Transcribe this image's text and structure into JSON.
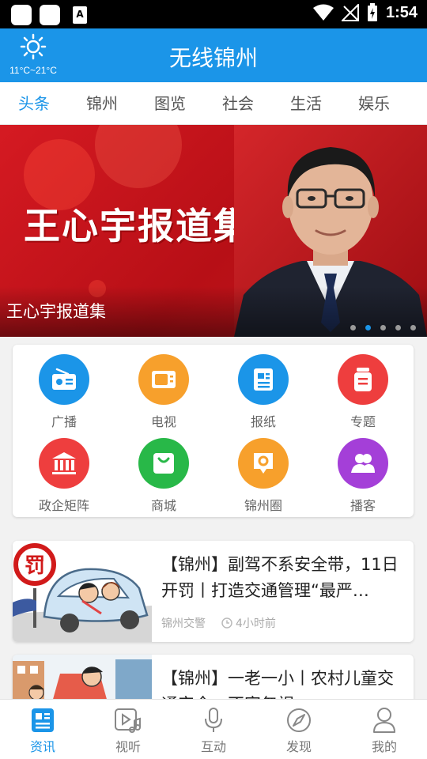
{
  "status_bar": {
    "time": "1:54"
  },
  "header": {
    "title": "无线锦州",
    "weather": {
      "temp": "11°C~21°C",
      "icon": "sun-icon"
    }
  },
  "tabs": [
    {
      "label": "头条",
      "active": true
    },
    {
      "label": "锦州"
    },
    {
      "label": "图览"
    },
    {
      "label": "社会"
    },
    {
      "label": "生活"
    },
    {
      "label": "娱乐"
    }
  ],
  "banner": {
    "headline": "王心宇报道集",
    "caption": "王心宇报道集",
    "slides": 5,
    "active_slide": 2
  },
  "services": [
    {
      "label": "广播",
      "icon": "radio-icon",
      "color": "#1b95e8"
    },
    {
      "label": "电视",
      "icon": "tv-icon",
      "color": "#f7a02c"
    },
    {
      "label": "报纸",
      "icon": "newspaper-icon",
      "color": "#1b95e8"
    },
    {
      "label": "专题",
      "icon": "topic-icon",
      "color": "#ee3e3e"
    },
    {
      "label": "政企矩阵",
      "icon": "government-icon",
      "color": "#ee3e3e"
    },
    {
      "label": "商城",
      "icon": "shopping-bag-icon",
      "color": "#28b848"
    },
    {
      "label": "锦州圈",
      "icon": "location-chat-icon",
      "color": "#f7a02c"
    },
    {
      "label": "播客",
      "icon": "podcast-icon",
      "color": "#a43fd8"
    }
  ],
  "news": [
    {
      "title": "【锦州】副驾不系安全带，11日开罚丨打造交通管理“最严…",
      "source": "锦州交警",
      "time": "4小时前",
      "badge": "罚"
    },
    {
      "title": "【锦州】一老一小丨农村儿童交通安全，不容忽视"
    }
  ],
  "bottom_nav": [
    {
      "label": "资讯",
      "icon": "news-icon",
      "active": true
    },
    {
      "label": "视听",
      "icon": "video-music-icon"
    },
    {
      "label": "互动",
      "icon": "microphone-icon"
    },
    {
      "label": "发现",
      "icon": "compass-icon"
    },
    {
      "label": "我的",
      "icon": "user-icon"
    }
  ],
  "colors": {
    "brand": "#1b95e8",
    "banner_red": "#c8161d"
  }
}
